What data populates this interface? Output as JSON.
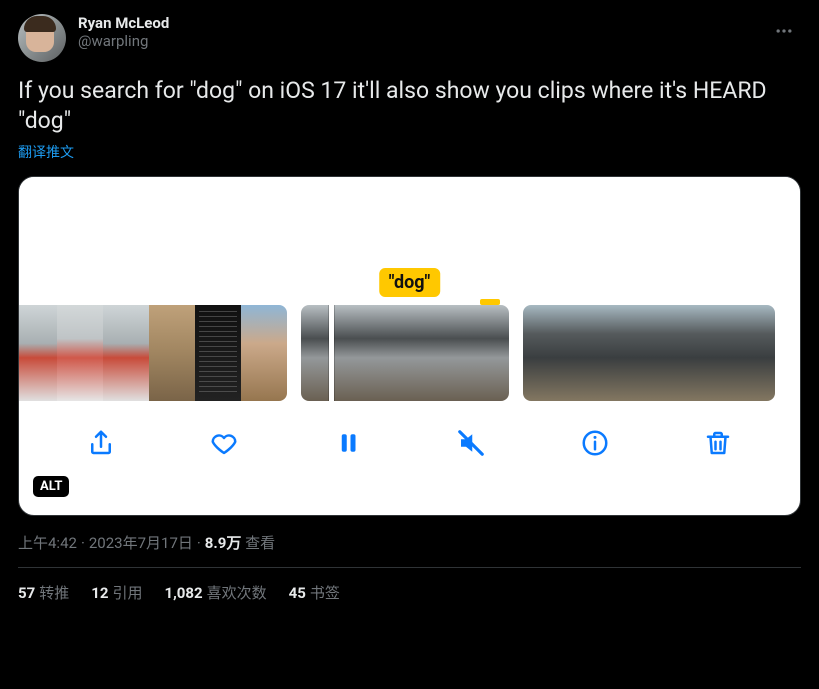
{
  "author": {
    "display_name": "Ryan McLeod",
    "handle": "@warpling"
  },
  "tweet_text": "If you search for \"dog\" on iOS 17 it'll also show you clips where it's HEARD \"dog\"",
  "translate_label": "翻译推文",
  "media": {
    "search_term_label": "\"dog\"",
    "alt_badge": "ALT"
  },
  "meta": {
    "time": "上午4:42",
    "date": "2023年7月17日",
    "views_count": "8.9万",
    "views_label": "查看"
  },
  "stats": {
    "retweets": {
      "count": "57",
      "label": "转推"
    },
    "quotes": {
      "count": "12",
      "label": "引用"
    },
    "likes": {
      "count": "1,082",
      "label": "喜欢次数"
    },
    "bookmarks": {
      "count": "45",
      "label": "书签"
    }
  }
}
